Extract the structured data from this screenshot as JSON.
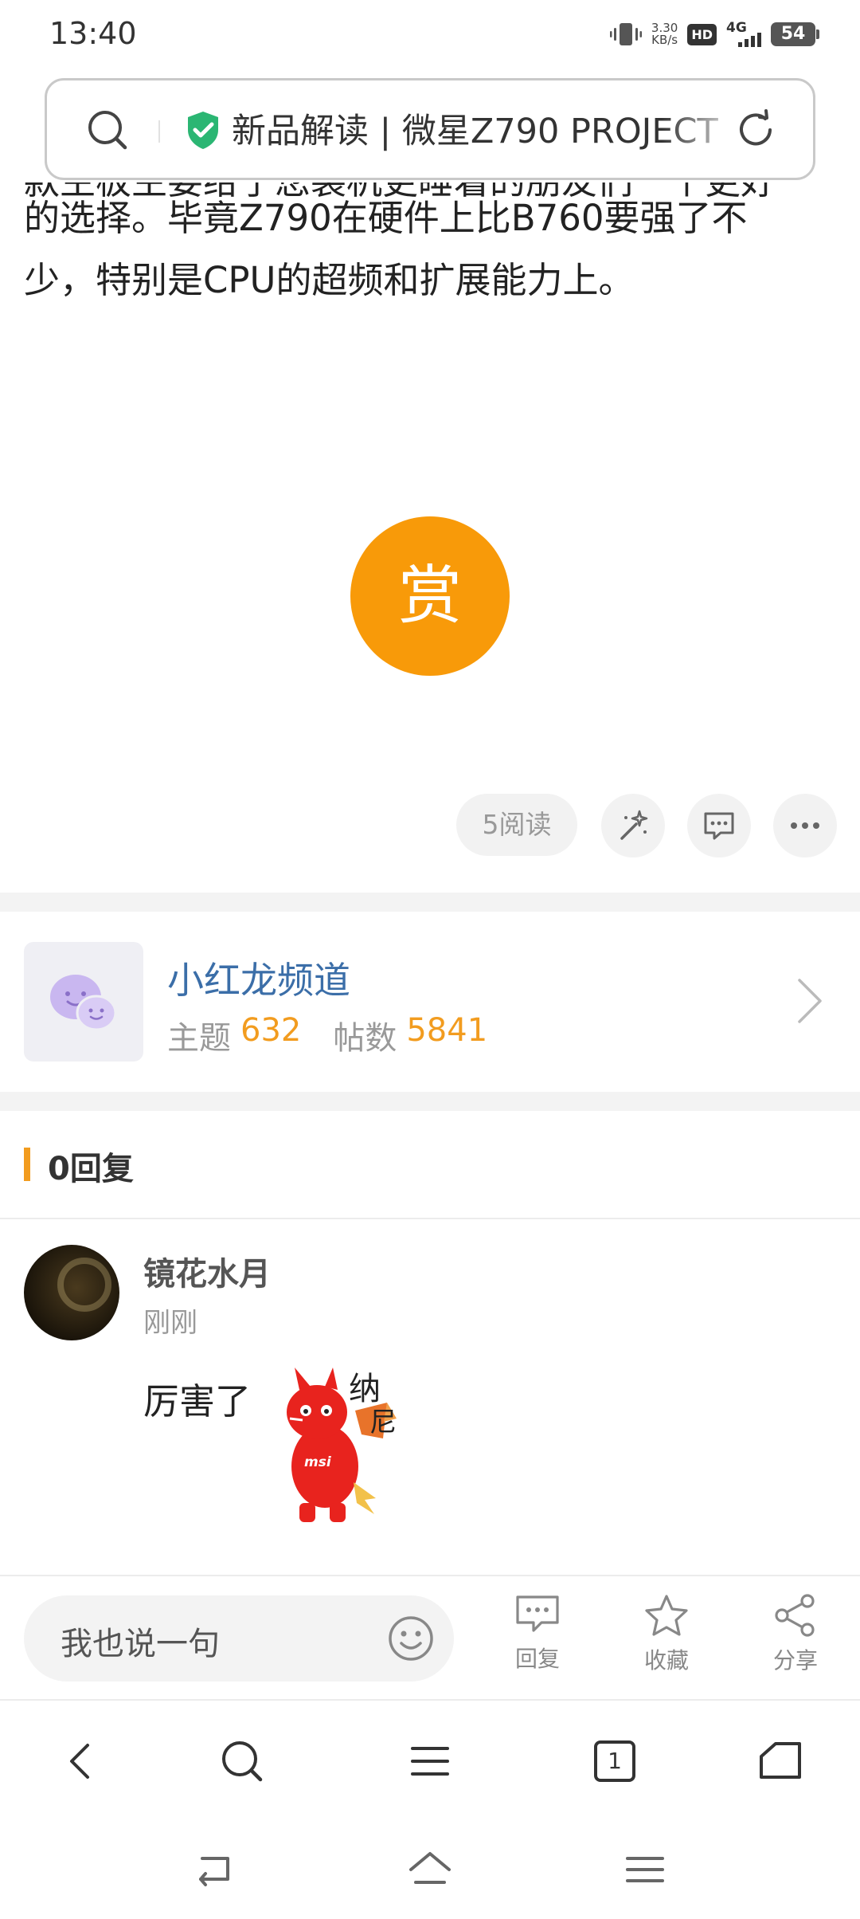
{
  "status_bar": {
    "time": "13:40",
    "speed_value": "3.30",
    "speed_unit": "KB/s",
    "hd_label": "HD",
    "network_label": "4G",
    "battery_level": "54"
  },
  "address_bar": {
    "page_title": "新品解读 | 微星Z790 PROJECT",
    "icons": [
      "search-icon",
      "shield-check-icon",
      "refresh-icon"
    ]
  },
  "article": {
    "cut_line": "款主板主要给了您装机更睡着的朋友们一个更好",
    "lines": [
      "的选择。毕竟Z790在硬件上比B760要强了不",
      "少，特别是CPU的超频和扩展能力上。"
    ]
  },
  "reward": {
    "label": "赏"
  },
  "actions": {
    "read_count": "5阅读",
    "icons": [
      "magic-wand-icon",
      "comment-icon",
      "more-icon"
    ]
  },
  "channel": {
    "name": "小红龙频道",
    "topics_label": "主题",
    "topics_count": "632",
    "posts_label": "帖数",
    "posts_count": "5841"
  },
  "replies": {
    "title": "0回复"
  },
  "comment": {
    "author": "镜花水月",
    "time": "刚刚",
    "text": "厉害了",
    "sticker_text_1": "纳",
    "sticker_text_2": "尼",
    "sticker_logo": "msi"
  },
  "input_bar": {
    "placeholder": "我也说一句",
    "reply_label": "回复",
    "favorite_label": "收藏",
    "share_label": "分享"
  },
  "browser_nav": {
    "tab_count": "1",
    "icons": [
      "back-icon",
      "search-icon",
      "menu-icon",
      "tabs-icon",
      "home-icon"
    ]
  },
  "colors": {
    "accent_orange": "#f89a09",
    "stat_orange": "#f29c1f",
    "channel_blue": "#3b6ea8"
  }
}
